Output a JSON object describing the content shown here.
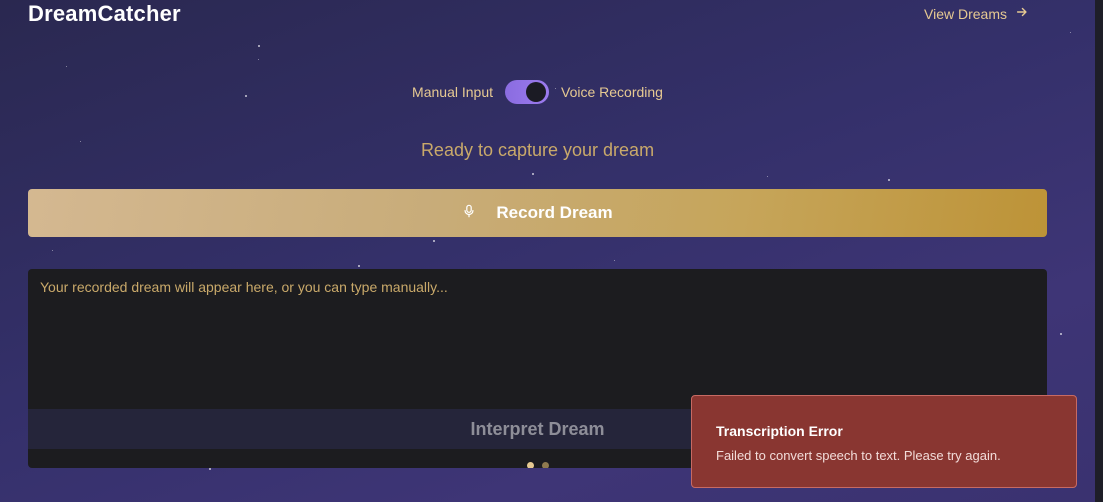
{
  "app": {
    "title": "DreamCatcher"
  },
  "header": {
    "view_dreams_label": "View Dreams",
    "arrow_icon": "arrow-right-icon"
  },
  "mode_toggle": {
    "left_label": "Manual Input",
    "right_label": "Voice Recording",
    "state": "voice"
  },
  "status": {
    "text": "Ready to capture your dream"
  },
  "record_button": {
    "label": "Record Dream",
    "icon": "microphone-icon"
  },
  "dream_input": {
    "value": "",
    "placeholder": "Your recorded dream will appear here, or you can type manually..."
  },
  "interpret_button": {
    "label": "Interpret Dream"
  },
  "pagination": {
    "total": 2,
    "active": 1
  },
  "toast": {
    "title": "Transcription Error",
    "message": "Failed to convert speech to text. Please try again."
  },
  "colors": {
    "accent_gold": "#c6a55a",
    "label_gold": "#e6c992",
    "toggle_purple": "#9c7bee",
    "error_red": "#893631",
    "background": "#34306a"
  }
}
